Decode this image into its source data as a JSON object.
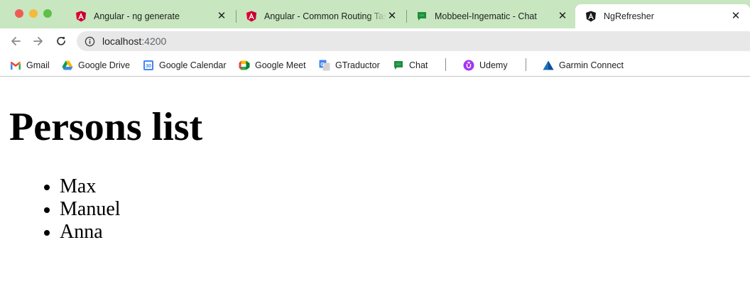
{
  "browser": {
    "tabs": [
      {
        "title": "Angular - ng generate",
        "icon": "angular-red-icon",
        "active": false
      },
      {
        "title": "Angular - Common Routing Tasks",
        "icon": "angular-red-icon",
        "active": false
      },
      {
        "title": "Mobbeel-Ingematic - Chat",
        "icon": "google-chat-icon",
        "active": false
      },
      {
        "title": "NgRefresher",
        "icon": "angular-black-icon",
        "active": true
      }
    ],
    "url_host": "localhost",
    "url_rest": ":4200",
    "bookmarks": [
      {
        "label": "Gmail",
        "icon": "gmail-icon"
      },
      {
        "label": "Google Drive",
        "icon": "google-drive-icon"
      },
      {
        "label": "Google Calendar",
        "icon": "google-calendar-icon"
      },
      {
        "label": "Google Meet",
        "icon": "google-meet-icon"
      },
      {
        "label": "GTraductor",
        "icon": "google-translate-icon"
      },
      {
        "label": "Chat",
        "icon": "google-chat-icon"
      },
      {
        "label": "Udemy",
        "icon": "udemy-icon"
      },
      {
        "label": "Garmin Connect",
        "icon": "garmin-icon"
      }
    ],
    "calendar_icon_day": "30"
  },
  "page": {
    "heading": "Persons list",
    "persons": [
      "Max",
      "Manuel",
      "Anna"
    ]
  },
  "colors": {
    "tabstrip": "#c8e6c0",
    "active_tab": "#ffffff",
    "omnibox": "#e8e8e8",
    "angular_red": "#dd0031"
  }
}
